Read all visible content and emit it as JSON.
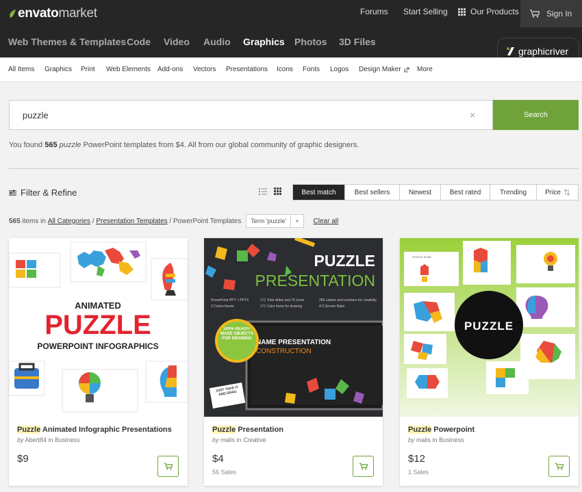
{
  "header": {
    "logo_bold": "envato",
    "logo_light": "market",
    "forums": "Forums",
    "start_selling": "Start Selling",
    "our_products": "Our Products",
    "sign_in": "Sign In"
  },
  "categories": [
    "Web Themes & Templates",
    "Code",
    "Video",
    "Audio",
    "Graphics",
    "Photos",
    "3D Files"
  ],
  "active_category": "Graphics",
  "badge": "graphicriver",
  "subnav": [
    "All Items",
    "Graphics",
    "Print",
    "Web Elements",
    "Add-ons",
    "Vectors",
    "Presentations",
    "Icons",
    "Fonts",
    "Logos",
    "Design Maker",
    "More"
  ],
  "search": {
    "value": "puzzle",
    "clear": "×",
    "button": "Search"
  },
  "results": {
    "prefix": "You found ",
    "count": "565",
    "term": "puzzle",
    "suffix": " PowerPoint templates from $4. All from our global community of graphic designers."
  },
  "filter_label": "Filter & Refine",
  "sort_options": [
    "Best match",
    "Best sellers",
    "Newest",
    "Best rated",
    "Trending",
    "Price"
  ],
  "breadcrumb": {
    "count": "565",
    "items_in": " items in ",
    "all_categories": "All Categories",
    "sep": " / ",
    "presentation_templates": "Presentation Templates",
    "powerpoint_templates": "PowerPoint Templates",
    "term_chip": "Term 'puzzle'",
    "term_x": "×",
    "clear_all": "Clear all"
  },
  "products": [
    {
      "title_hl": "Puzzle",
      "title_rest": " Animated Infographic Presentations",
      "by": "by",
      "author": "Abert84",
      "in": " in ",
      "category": "Business",
      "price": "$9",
      "sales": "",
      "thumb": {
        "l1": "ANIMATED",
        "l2": "PUZZLE",
        "l3": "POWERPOINT INFOGRAPHICS"
      }
    },
    {
      "title_hl": "Puzzle",
      "title_rest": " Presentation",
      "by": "by",
      "author": "malis",
      "in": " in ",
      "category": "Creative",
      "price": "$4",
      "sales": "56 Sales",
      "thumb": {
        "l1": "PUZZLE",
        "l2": "PRESENTATION",
        "badge": "100% READY-MADE OBJECTS FOR DRAWING",
        "screen": "NAME PRESENTATION",
        "screen2": "CONSTRUCTION",
        "sign": "JUST TAKE IT AND DRAG",
        "s1": "PowerPoint PPT + PPTX",
        "s2": "2 Colors theme",
        "s3": "171 Total slides and 76 Icons",
        "s4": "171 Color items for drawing",
        "s5": "286 Letters and numbers for creativity",
        "s6": "4:3 Screen Ratio"
      }
    },
    {
      "title_hl": "Puzzle",
      "title_rest": " Powerpoint",
      "by": "by",
      "author": "malis",
      "in": " in ",
      "category": "Business",
      "price": "$12",
      "sales": "1 Sales",
      "thumb": {
        "l1": "PUZZLE",
        "slide": "PUZZLE SLIDE"
      }
    }
  ],
  "colors": {
    "accent_green": "#6fa33a",
    "dark_bar": "#262626",
    "highlight": "#fdf3b7",
    "puzzle_red": "#e2242f"
  }
}
